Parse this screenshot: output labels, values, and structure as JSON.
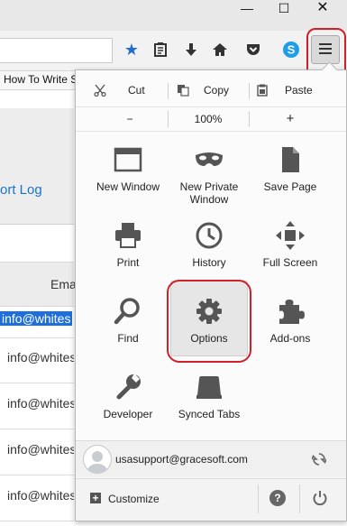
{
  "window": {
    "minimize_glyph": "—",
    "maximize_glyph": "☐",
    "close_glyph": "✕"
  },
  "toolbar": {
    "icons": [
      "bookmark-star-icon",
      "reading-list-icon",
      "download-icon",
      "home-icon",
      "pocket-icon",
      "skype-icon",
      "hamburger-menu-icon"
    ]
  },
  "bookmarks": {
    "item_label": "How To Write S"
  },
  "page": {
    "support_log_text": "ort Log",
    "table_header": "Ema",
    "rows": [
      "info@whites",
      "info@whites",
      "info@whites",
      "info@whites",
      "info@whites"
    ]
  },
  "menu": {
    "edit": {
      "cut": "Cut",
      "copy": "Copy",
      "paste": "Paste"
    },
    "zoom": {
      "minus": "−",
      "level": "100%",
      "plus": "+"
    },
    "items": [
      {
        "label": "New Window",
        "icon": "new-window-icon"
      },
      {
        "label": "New Private Window",
        "icon": "private-mask-icon"
      },
      {
        "label": "Save Page",
        "icon": "save-page-icon"
      },
      {
        "label": "Print",
        "icon": "print-icon"
      },
      {
        "label": "History",
        "icon": "history-clock-icon"
      },
      {
        "label": "Full Screen",
        "icon": "fullscreen-icon"
      },
      {
        "label": "Find",
        "icon": "search-icon"
      },
      {
        "label": "Options",
        "icon": "gear-icon"
      },
      {
        "label": "Add-ons",
        "icon": "puzzle-icon"
      },
      {
        "label": "Developer",
        "icon": "wrench-icon"
      },
      {
        "label": "Synced Tabs",
        "icon": "synced-tabs-icon"
      }
    ],
    "account_email": "usasupport@gracesoft.com",
    "customize_label": "Customize",
    "help_glyph": "?"
  },
  "colors": {
    "accent_blue": "#1f6fd0",
    "highlight_red": "#d0202a",
    "selection_blue": "#1e6fd9"
  }
}
